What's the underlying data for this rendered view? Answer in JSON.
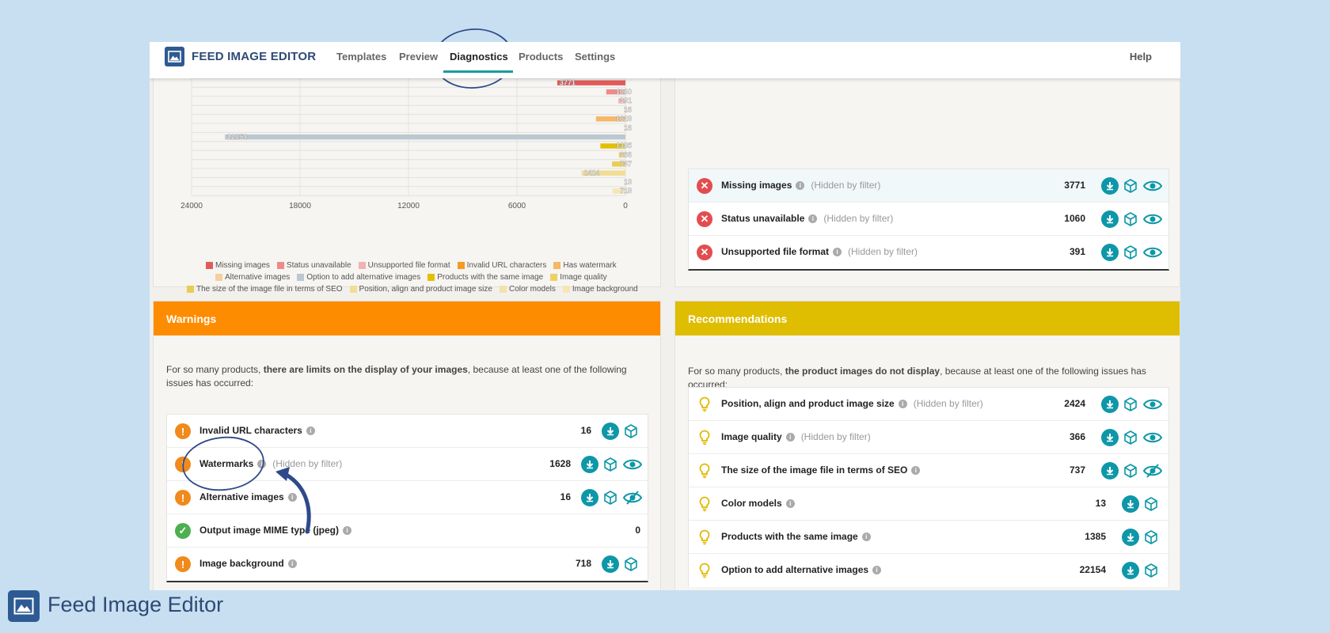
{
  "brand": {
    "name": "FEED IMAGE EDITOR"
  },
  "nav": {
    "items": [
      "Templates",
      "Preview",
      "Diagnostics",
      "Products",
      "Settings"
    ],
    "active": "Diagnostics",
    "help": "Help"
  },
  "colors": {
    "accent": "#0e97a8",
    "warnings_header": "#fe8c00",
    "recommendations_header": "#dfbd00",
    "error": "#e34d4f",
    "warn": "#f08a1c",
    "ok": "#4caf50",
    "bulb": "#e2b800"
  },
  "chart_data": {
    "type": "bar",
    "orientation": "horizontal",
    "categories": [
      "Missing images",
      "Status unavailable",
      "Unsupported file format",
      "Invalid URL characters",
      "Has watermark",
      "Alternative images",
      "Option to add alternative images",
      "Products with the same image",
      "Image quality",
      "The size of the image file in terms of SEO",
      "Position, align and product image size",
      "Color models",
      "Image background"
    ],
    "values": [
      3771,
      1060,
      391,
      16,
      1628,
      16,
      22154,
      1385,
      366,
      737,
      2424,
      13,
      718
    ],
    "colors": [
      "#e25b5b",
      "#ee8a8a",
      "#f4b1b1",
      "#f69a23",
      "#f5b768",
      "#f7cf9b",
      "#bcc7d0",
      "#e2c000",
      "#eed165",
      "#e8cc55",
      "#f1de95",
      "#f3e2a9",
      "#f5e6b6"
    ],
    "xlim": [
      24000,
      0
    ],
    "xticks": [
      "24000",
      "18000",
      "12000",
      "6000",
      "0"
    ],
    "grid": true,
    "legend": "bottom"
  },
  "errors": {
    "rows": [
      {
        "label": "Missing images",
        "note": "(Hidden by filter)",
        "count": "3771",
        "eye": "eye"
      },
      {
        "label": "Status unavailable",
        "note": "(Hidden by filter)",
        "count": "1060",
        "eye": "eye"
      },
      {
        "label": "Unsupported file format",
        "note": "(Hidden by filter)",
        "count": "391",
        "eye": "eye"
      }
    ]
  },
  "warnings": {
    "title": "Warnings",
    "desc_pre": "For so many products, ",
    "desc_bold": "there are limits on the display of your images",
    "desc_post": ", because at least one of the following issues has occurred:",
    "rows": [
      {
        "label": "Invalid URL characters",
        "note": "",
        "count": "16",
        "status": "warn"
      },
      {
        "label": "Watermarks",
        "note": "(Hidden by filter)",
        "count": "1628",
        "status": "warn"
      },
      {
        "label": "Alternative images",
        "note": "",
        "count": "16",
        "status": "warn"
      },
      {
        "label": "Output image MIME type (jpeg)",
        "note": "",
        "count": "0",
        "status": "ok"
      },
      {
        "label": "Image background",
        "note": "",
        "count": "718",
        "status": "warn"
      }
    ]
  },
  "recommendations": {
    "title": "Recommendations",
    "desc_pre": "For so many products, ",
    "desc_bold": "the product images do not display",
    "desc_post": ", because at least one of the following issues has occurred:",
    "rows": [
      {
        "label": "Position, align and product image size",
        "note": "(Hidden by filter)",
        "count": "2424"
      },
      {
        "label": "Image quality",
        "note": "(Hidden by filter)",
        "count": "366"
      },
      {
        "label": "The size of the image file in terms of SEO",
        "note": "",
        "count": "737"
      },
      {
        "label": "Color models",
        "note": "",
        "count": "13"
      },
      {
        "label": "Products with the same image",
        "note": "",
        "count": "1385"
      },
      {
        "label": "Option to add alternative images",
        "note": "",
        "count": "22154"
      }
    ]
  },
  "footer": {
    "title": "Feed Image Editor"
  }
}
